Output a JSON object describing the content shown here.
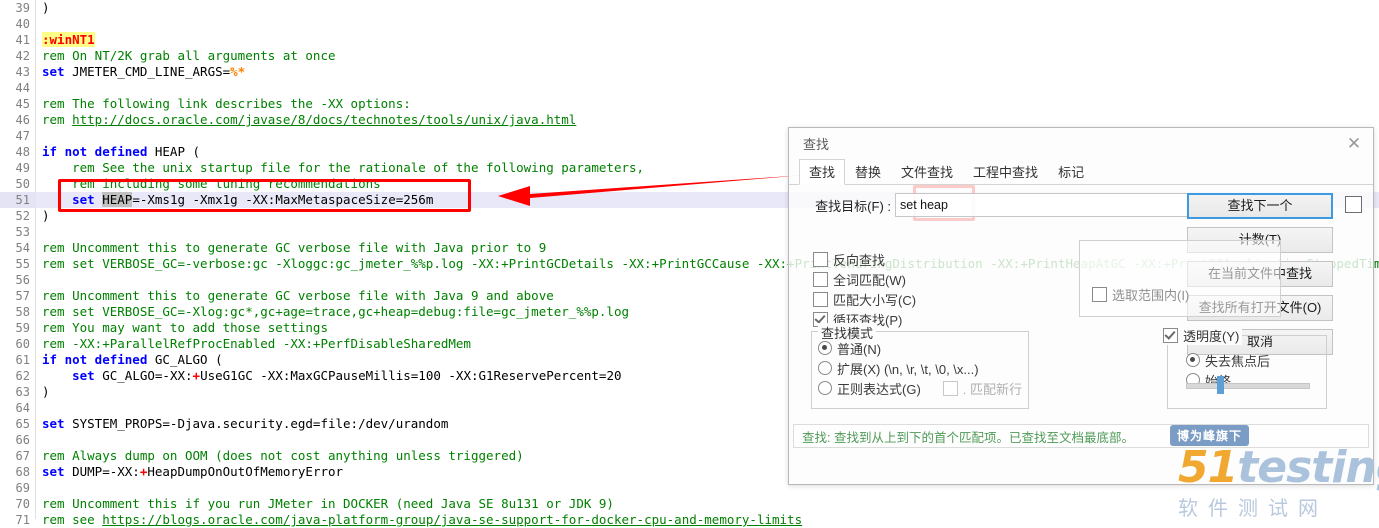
{
  "editor": {
    "first_line_number": 39,
    "current_line": 51,
    "lines": [
      {
        "n": 39,
        "segments": [
          {
            "t": ")",
            "c": "pl"
          }
        ]
      },
      {
        "n": 40,
        "segments": []
      },
      {
        "n": 41,
        "segments": [
          {
            "t": ":winNT1",
            "c": "lbl"
          }
        ]
      },
      {
        "n": 42,
        "segments": [
          {
            "t": "rem On NT/2K grab all arguments at once",
            "c": "rem"
          }
        ]
      },
      {
        "n": 43,
        "segments": [
          {
            "t": "set",
            "c": "kw"
          },
          {
            "t": " JMETER_CMD_LINE_ARGS=",
            "c": "pl"
          },
          {
            "t": "%*",
            "c": "op"
          }
        ]
      },
      {
        "n": 44,
        "segments": []
      },
      {
        "n": 45,
        "segments": [
          {
            "t": "rem The following link describes the -XX options:",
            "c": "rem"
          }
        ]
      },
      {
        "n": 46,
        "segments": [
          {
            "t": "rem ",
            "c": "rem"
          },
          {
            "t": "http://docs.oracle.com/javase/8/docs/technotes/tools/unix/java.html",
            "c": "lnk"
          }
        ]
      },
      {
        "n": 47,
        "segments": []
      },
      {
        "n": 48,
        "segments": [
          {
            "t": "if not defined",
            "c": "kw"
          },
          {
            "t": " HEAP (",
            "c": "pl"
          }
        ]
      },
      {
        "n": 49,
        "segments": [
          {
            "t": "    rem See the unix startup file for the rationale of the following parameters,",
            "c": "rem"
          }
        ]
      },
      {
        "n": 50,
        "segments": [
          {
            "t": "    rem including some tuning recommendations",
            "c": "rem"
          }
        ]
      },
      {
        "n": 51,
        "segments": [
          {
            "t": "    ",
            "c": "pl"
          },
          {
            "t": "set",
            "c": "kw"
          },
          {
            "t": " ",
            "c": "pl"
          },
          {
            "t": "HEAP",
            "c": "sel"
          },
          {
            "t": "=-Xms1g -Xmx1g -XX:MaxMetaspaceSize=256m",
            "c": "pl"
          }
        ]
      },
      {
        "n": 52,
        "segments": [
          {
            "t": ")",
            "c": "pl"
          }
        ]
      },
      {
        "n": 53,
        "segments": []
      },
      {
        "n": 54,
        "segments": [
          {
            "t": "rem Uncomment this to generate GC verbose file with Java prior to 9",
            "c": "rem"
          }
        ]
      },
      {
        "n": 55,
        "segments": [
          {
            "t": "rem set VERBOSE_GC=-verbose:gc -Xloggc:gc_jmeter_%%p.log -XX:+PrintGCDetails -XX:+PrintGCCause -XX:+PrintTenuringDistribution -XX:+PrintHeapAtGC -XX:+PrintGCApplicationStoppedTime",
            "c": "rem"
          }
        ]
      },
      {
        "n": 56,
        "segments": []
      },
      {
        "n": 57,
        "segments": [
          {
            "t": "rem Uncomment this to generate GC verbose file with Java 9 and above",
            "c": "rem"
          }
        ]
      },
      {
        "n": 58,
        "segments": [
          {
            "t": "rem set VERBOSE_GC=-Xlog:gc*,gc+age=trace,gc+heap=debug:file=gc_jmeter_%%p.log",
            "c": "rem"
          }
        ]
      },
      {
        "n": 59,
        "segments": [
          {
            "t": "rem You may want to add those settings",
            "c": "rem"
          }
        ]
      },
      {
        "n": 60,
        "segments": [
          {
            "t": "rem -XX:+ParallelRefProcEnabled -XX:+PerfDisableSharedMem",
            "c": "rem"
          }
        ]
      },
      {
        "n": 61,
        "segments": [
          {
            "t": "if not defined",
            "c": "kw"
          },
          {
            "t": " GC_ALGO (",
            "c": "pl"
          }
        ]
      },
      {
        "n": 62,
        "segments": [
          {
            "t": "    ",
            "c": "pl"
          },
          {
            "t": "set",
            "c": "kw"
          },
          {
            "t": " GC_ALGO=-XX:",
            "c": "pl"
          },
          {
            "t": "+",
            "c": "red"
          },
          {
            "t": "UseG1GC -XX:MaxGCPauseMillis=100 -XX:G1ReservePercent=20",
            "c": "pl"
          }
        ]
      },
      {
        "n": 63,
        "segments": [
          {
            "t": ")",
            "c": "pl"
          }
        ]
      },
      {
        "n": 64,
        "segments": []
      },
      {
        "n": 65,
        "segments": [
          {
            "t": "set",
            "c": "kw"
          },
          {
            "t": " SYSTEM_PROPS=-Djava.security.egd=file:/dev/urandom",
            "c": "pl"
          }
        ]
      },
      {
        "n": 66,
        "segments": []
      },
      {
        "n": 67,
        "segments": [
          {
            "t": "rem Always dump on OOM (does not cost anything unless triggered)",
            "c": "rem"
          }
        ]
      },
      {
        "n": 68,
        "segments": [
          {
            "t": "set",
            "c": "kw"
          },
          {
            "t": " DUMP=-XX:",
            "c": "pl"
          },
          {
            "t": "+",
            "c": "red"
          },
          {
            "t": "HeapDumpOnOutOfMemoryError",
            "c": "pl"
          }
        ]
      },
      {
        "n": 69,
        "segments": []
      },
      {
        "n": 70,
        "segments": [
          {
            "t": "rem Uncomment this if you run JMeter in DOCKER (need Java SE 8u131 or JDK 9)",
            "c": "rem"
          }
        ]
      },
      {
        "n": 71,
        "segments": [
          {
            "t": "rem see ",
            "c": "rem"
          },
          {
            "t": "https://blogs.oracle.com/java-platform-group/java-se-support-for-docker-cpu-and-memory-limits",
            "c": "lnk"
          }
        ]
      }
    ]
  },
  "dialog": {
    "title": "查找",
    "close_label": "✕",
    "tabs": [
      {
        "label": "查找",
        "active": true
      },
      {
        "label": "替换",
        "active": false
      },
      {
        "label": "文件查找",
        "active": false
      },
      {
        "label": "工程中查找",
        "active": false
      },
      {
        "label": "标记",
        "active": false
      }
    ],
    "find_label": "查找目标(F) :",
    "find_value": "set heap",
    "find_placeholder": "",
    "buttons": {
      "find_next": "查找下一个",
      "count": "计数(T)",
      "find_in_current_file": "在当前文件中查找",
      "find_all_open": "查找所有打开文件(O)",
      "cancel": "取消"
    },
    "checkboxes": [
      {
        "label": "反向查找",
        "checked": false
      },
      {
        "label": "全词匹配(W)",
        "checked": false
      },
      {
        "label": "匹配大小写(C)",
        "checked": false
      },
      {
        "label": "循环查找(P)",
        "checked": true
      }
    ],
    "in_selection_label": "选取范围内(I)",
    "in_selection_checked": false,
    "search_mode": {
      "legend": "查找模式",
      "options": [
        {
          "label": "普通(N)",
          "selected": true
        },
        {
          "label": "扩展(X) (\\n, \\r, \\t, \\0, \\x...)",
          "selected": false
        },
        {
          "label": "正则表达式(G)",
          "selected": false
        }
      ],
      "newline_label": ". 匹配新行",
      "newline_checked": false
    },
    "transparency": {
      "label": "透明度(Y)",
      "checked": true,
      "options": [
        {
          "label": "失去焦点后",
          "selected": true
        },
        {
          "label": "始终",
          "selected": false
        }
      ],
      "slider_value": 25
    },
    "status": "查找: 查找到从上到下的首个匹配项。已查找至文档最底部。"
  },
  "watermarks": {
    "badge": "博为峰旗下",
    "brand_51": "51",
    "brand_testing": "testing",
    "brand_sub": "软件测试网"
  },
  "colors": {
    "accent_blue": "#3d9ae0",
    "annotation_red": "#ff0000",
    "comment_green": "#008000",
    "keyword_blue": "#0000ff",
    "label_yellow": "#ffff88",
    "status_green": "#4f9a57"
  }
}
